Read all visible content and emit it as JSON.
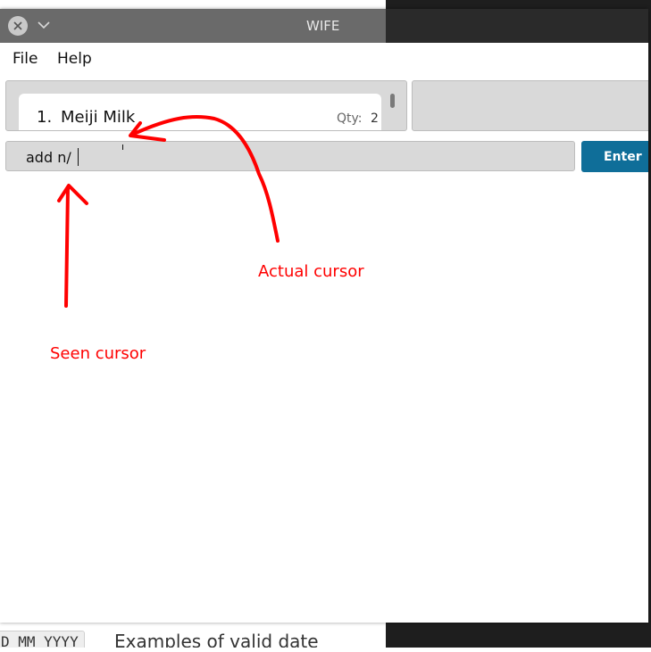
{
  "window": {
    "title": "WIFE"
  },
  "menu": {
    "file": "File",
    "help": "Help"
  },
  "list": {
    "items": [
      {
        "index": "1.",
        "name": "Meiji Milk",
        "qty_label": "Qty:",
        "qty": "2"
      }
    ]
  },
  "command": {
    "value": "add n/"
  },
  "enter_button": {
    "label": "Enter"
  },
  "annotations": {
    "actual_cursor": "Actual cursor",
    "seen_cursor": "Seen cursor",
    "color": "#ff0000"
  },
  "background": {
    "doc_code": "D MM YYYY",
    "doc_text": "Examples of valid date"
  },
  "colors": {
    "enter_button": "#0f6e99",
    "panel": "#d9d9d9",
    "titlebar": "#6a6a6a"
  },
  "icons": {
    "close": "close-icon",
    "menu": "chevron-down-icon"
  }
}
